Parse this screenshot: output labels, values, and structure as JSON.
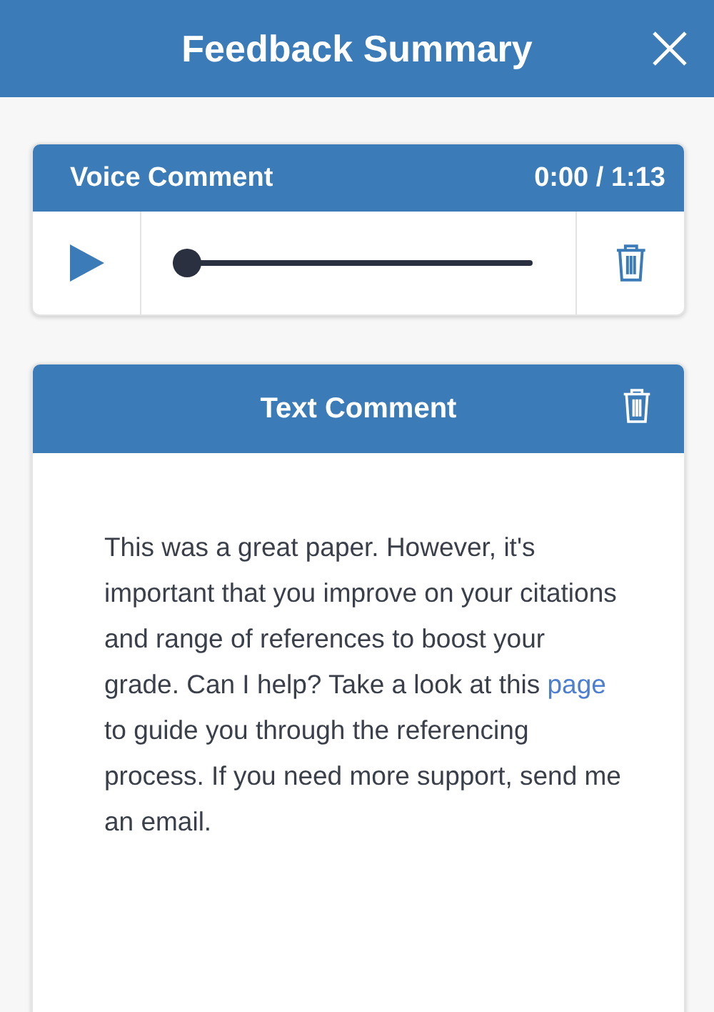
{
  "header": {
    "title": "Feedback Summary"
  },
  "voice_comment": {
    "title": "Voice Comment",
    "time": "0:00 / 1:13",
    "level": 0
  },
  "text_comment": {
    "title": "Text Comment",
    "text_before": "This was a great paper. However, it's important that you improve on your citations and range of references to boost your grade. Can I help? Take a look at this",
    "link": "page",
    "text_after": "to guide you through the referencing process. If you need more support, send me an email."
  }
}
